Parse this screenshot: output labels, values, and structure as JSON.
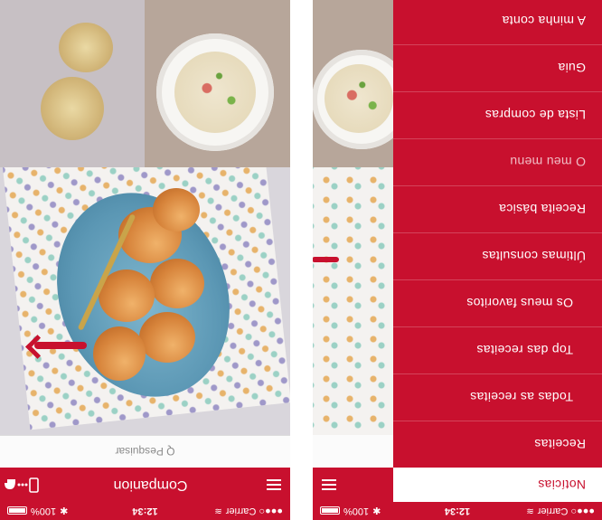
{
  "colors": {
    "brand": "#c8102e",
    "white": "#ffffff"
  },
  "status": {
    "carrier": "●●●○ Carrier",
    "wifi_icon": "wifi-icon",
    "time": "12:34",
    "bluetooth": "✱",
    "battery_pct": "100%",
    "battery_icon": "battery-icon"
  },
  "right_screen": {
    "title": "Companion",
    "search_placeholder": "Q Pesquisar",
    "menu_icon": "hamburger-menu-icon",
    "companion_icon": "companion-device-icon"
  },
  "left_screen": {
    "menu": [
      {
        "label": "Notícias",
        "state": "active"
      },
      {
        "label": "Receitas"
      },
      {
        "label": "Todas as receitas",
        "sub": true
      },
      {
        "label": "Top das receitas",
        "sub": true
      },
      {
        "label": "Os meus favoritos",
        "sub": true
      },
      {
        "label": "Últimas consultas"
      },
      {
        "label": "Receita básica"
      },
      {
        "label": "O meu menu",
        "state": "dim"
      },
      {
        "label": "Lista de compras"
      },
      {
        "label": "Guia"
      },
      {
        "label": "A minha conta"
      }
    ]
  }
}
